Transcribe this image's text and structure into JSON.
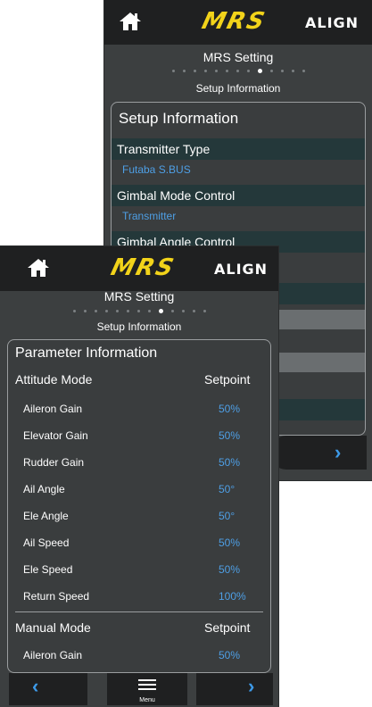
{
  "back_screen": {
    "brand": {
      "logo": "MRS",
      "maker": "ALIGN"
    },
    "header": {
      "title": "MRS Setting",
      "subtitle": "Setup Information"
    },
    "panel": {
      "title": "Setup Information",
      "rows": [
        {
          "label": "Transmitter Type",
          "value": "Futaba S.BUS"
        },
        {
          "label": "Gimbal Mode Control",
          "value": "Transmitter"
        },
        {
          "label": "Gimbal Angle Control"
        }
      ]
    },
    "nav": {
      "next_icon": "chevron-right-icon"
    }
  },
  "front_screen": {
    "brand": {
      "logo": "MRS",
      "maker": "ALIGN"
    },
    "header": {
      "title": "MRS Setting",
      "subtitle": "Setup Information"
    },
    "panel": {
      "title": "Parameter Information",
      "attitude": {
        "label": "Attitude Mode",
        "column": "Setpoint",
        "rows": [
          {
            "label": "Aileron Gain",
            "value": "50%"
          },
          {
            "label": "Elevator Gain",
            "value": "50%"
          },
          {
            "label": "Rudder Gain",
            "value": "50%"
          },
          {
            "label": "Ail Angle",
            "value": "50°"
          },
          {
            "label": "Ele Angle",
            "value": "50°"
          },
          {
            "label": "Ail Speed",
            "value": "50%"
          },
          {
            "label": "Ele Speed",
            "value": "50%"
          },
          {
            "label": "Return Speed",
            "value": "100%"
          }
        ]
      },
      "manual": {
        "label": "Manual Mode",
        "column": "Setpoint",
        "rows": [
          {
            "label": "Aileron Gain",
            "value": "50%"
          }
        ]
      }
    },
    "nav": {
      "menu_label": "Menu"
    }
  },
  "colors": {
    "accent": "#3d9ae8",
    "value_blue": "#4e9fe5",
    "logo_yellow": "#f2d31a",
    "bar": "#1f2021"
  }
}
